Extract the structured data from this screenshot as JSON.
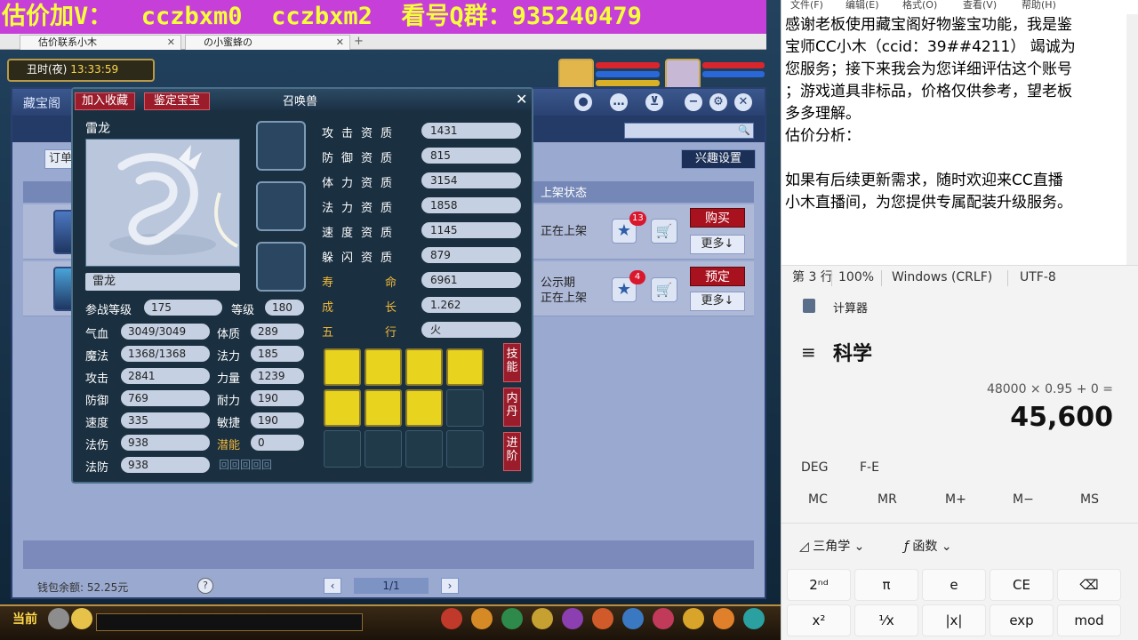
{
  "stream_banner": "估价加V：  cczbxm0  cczbxm2  看号Q群：935240479",
  "browser": {
    "tabs": [
      "估价联系小木",
      "の小蜜蜂の"
    ]
  },
  "game": {
    "clock": "丑时(夜)",
    "clock_time": "13:33:59",
    "treasure_window": {
      "title": "藏宝阁",
      "interest_button": "兴趣设置",
      "order_box": "订单",
      "status_header": "上架状态",
      "listings": [
        {
          "status": "正在上架",
          "badge": "13",
          "action": "购买",
          "more": "更多↓"
        },
        {
          "status": "公示期\n正在上架",
          "badge": "4",
          "action": "预定",
          "more": "更多↓"
        }
      ],
      "wallet": "钱包余额: 52.25元",
      "page": "1/1"
    },
    "pet_panel": {
      "title": "召唤兽",
      "tab_favorite": "加入收藏",
      "tab_appraise": "鉴定宝宝",
      "name_top": "雷龙",
      "name": "雷龙",
      "labels": {
        "battle_level": "参战等级",
        "level": "等级",
        "hp": "气血",
        "constitution": "体质",
        "mp": "魔法",
        "magic": "法力",
        "attack": "攻击",
        "strength": "力量",
        "defense": "防御",
        "endurance": "耐力",
        "speed": "速度",
        "agility": "敏捷",
        "magic_damage": "法伤",
        "potential": "潜能",
        "magic_defense": "法防"
      },
      "values": {
        "battle_level": "175",
        "level": "180",
        "hp": "3049/3049",
        "constitution": "289",
        "mp": "1368/1368",
        "magic": "185",
        "attack": "2841",
        "strength": "1239",
        "defense": "769",
        "endurance": "190",
        "speed": "335",
        "agility": "190",
        "magic_damage": "938",
        "potential": "0",
        "magic_defense": "938"
      },
      "aptitudes": [
        {
          "label": "攻击资质",
          "value": "1431"
        },
        {
          "label": "防御资质",
          "value": "815"
        },
        {
          "label": "体力资质",
          "value": "3154"
        },
        {
          "label": "法力资质",
          "value": "1858"
        },
        {
          "label": "速度资质",
          "value": "1145"
        },
        {
          "label": "躲闪资质",
          "value": "879"
        },
        {
          "label": "寿命",
          "value": "6961"
        },
        {
          "label": "成长",
          "value": "1.262"
        },
        {
          "label": "五行",
          "value": "火"
        }
      ],
      "side_tabs": [
        "技能",
        "内丹",
        "进阶"
      ]
    },
    "bottom_bar": {
      "current": "当前"
    }
  },
  "notepad": {
    "menu": [
      "文件(F)",
      "编辑(E)",
      "格式(O)",
      "查看(V)",
      "帮助(H)"
    ],
    "lines": [
      "感谢老板使用藏宝阁好物鉴宝功能，我是鉴",
      "宝师CC小木（ccid：39##4211）    竭诚为",
      "您服务；接下来我会为您详细评估这个账号",
      "；游戏道具非标品，价格仅供参考，望老板",
      "多多理解。",
      "估价分析：",
      "",
      "如果有后续更新需求，随时欢迎来CC直播",
      "小木直播间，为您提供专属配装升级服务。"
    ],
    "status": {
      "position": "第 3 行",
      "zoom": "100%",
      "line_ending": "Windows (CRLF)",
      "encoding": "UTF-8"
    }
  },
  "calculator": {
    "title": "计算器",
    "mode": "科学",
    "expression": "48000 × 0.95 + 0 =",
    "display": "45,600",
    "angle": "DEG",
    "fe": "F-E",
    "memory": [
      "MC",
      "MR",
      "M+",
      "M−",
      "MS"
    ],
    "trig": "三角学",
    "func": "函数",
    "keys_row1": [
      "2ⁿᵈ",
      "π",
      "e",
      "CE",
      "⌫"
    ],
    "keys_row2": [
      "x²",
      "¹⁄x",
      "|x|",
      "exp",
      "mod"
    ]
  }
}
